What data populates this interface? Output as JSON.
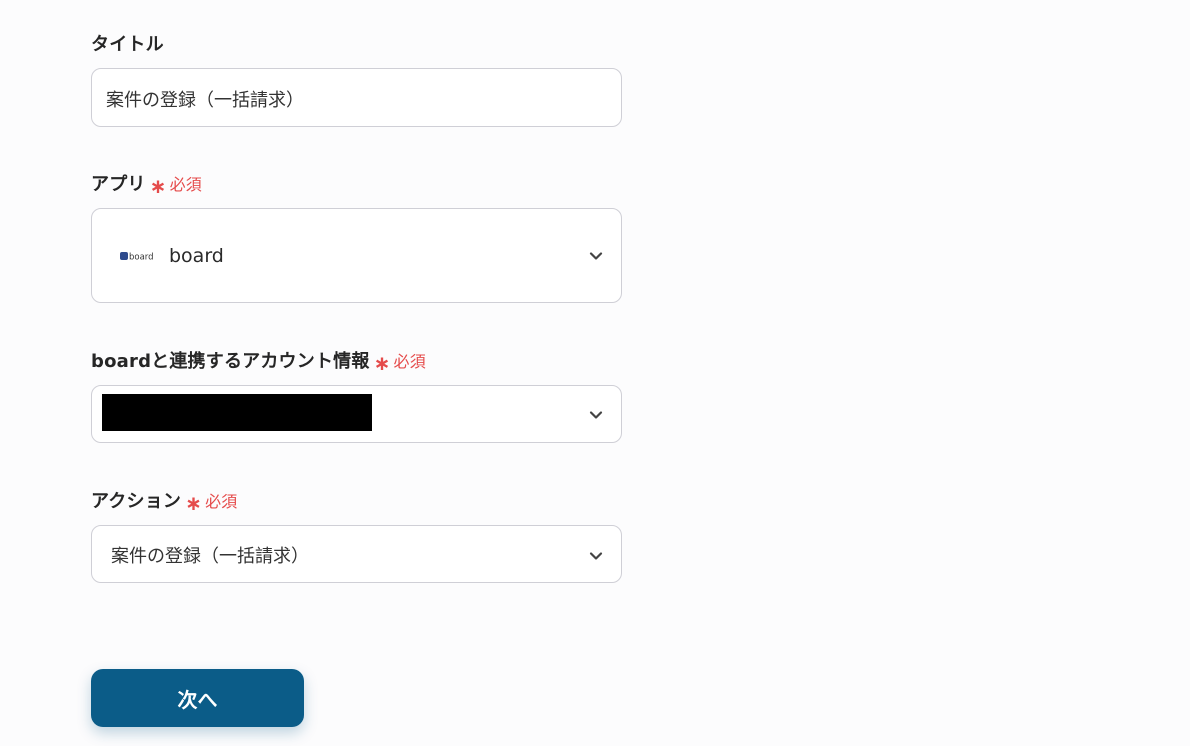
{
  "title_field": {
    "label": "タイトル",
    "value": "案件の登録（一括請求）"
  },
  "app_field": {
    "label": "アプリ",
    "required_mark": "∗",
    "required_text": "必須",
    "value": "board",
    "logo_text": "board",
    "icon": "chevron-down-icon"
  },
  "account_field": {
    "label": "boardと連携するアカウント情報",
    "required_mark": "∗",
    "required_text": "必須",
    "value_redacted": true,
    "icon": "chevron-down-icon"
  },
  "action_field": {
    "label": "アクション",
    "required_mark": "∗",
    "required_text": "必須",
    "value": "案件の登録（一括請求）",
    "icon": "chevron-down-icon"
  },
  "next_button": {
    "label": "次へ",
    "color": "#0b5c88"
  },
  "colors": {
    "required": "#e54b4b",
    "border": "#cfcfd6",
    "background": "#fcfcfd"
  }
}
